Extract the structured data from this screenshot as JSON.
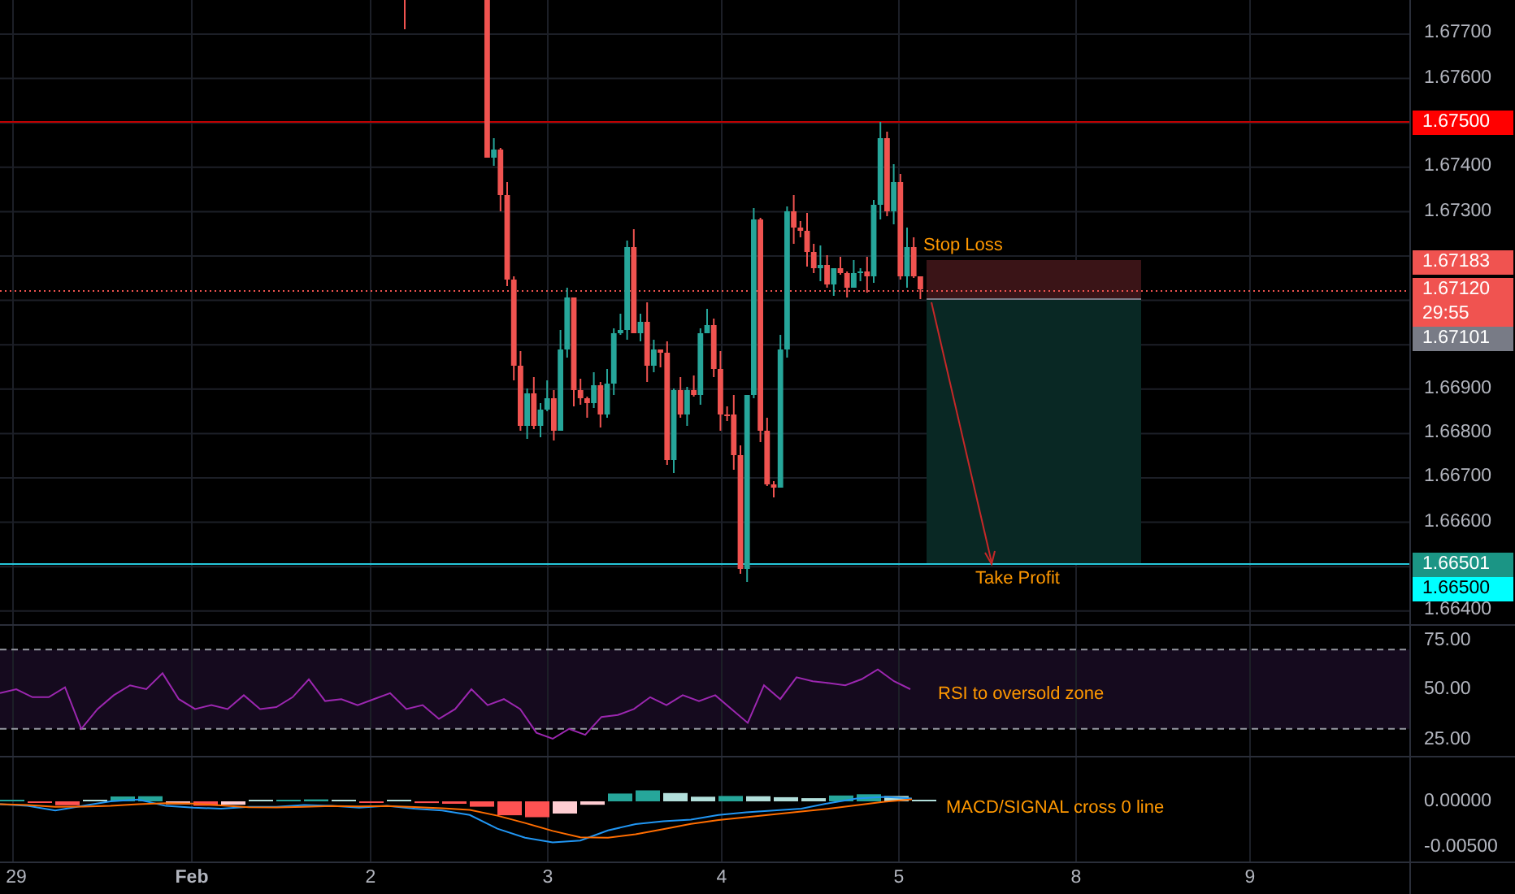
{
  "main_pane": {
    "annotations": [
      {
        "kind": "stop",
        "text": "Stop Loss"
      },
      {
        "kind": "target",
        "text": "Take Profit"
      }
    ],
    "price_axis": {
      "ticks": [
        "1.67700",
        "1.67600",
        "1.67400",
        "1.67300",
        "1.66900",
        "1.66800",
        "1.66700",
        "1.66600",
        "1.66400"
      ],
      "badges": [
        {
          "label": "1.67500",
          "color": "#ff0000"
        },
        {
          "label": "1.67183",
          "color": "#f05350"
        },
        {
          "label": "1.67120",
          "color": "#f05350"
        },
        {
          "label": "29:55",
          "color": "#f05350"
        },
        {
          "label": "1.67101",
          "color": "#787b86"
        },
        {
          "label": "1.66501",
          "color": "#1b9585"
        },
        {
          "label": "1.66500",
          "color": "#00ffff"
        }
      ]
    }
  },
  "rsi_pane": {
    "annotation": "RSI to oversold zone",
    "ticks": [
      "75.00",
      "50.00",
      "25.00"
    ]
  },
  "macd_pane": {
    "annotation": "MACD/SIGNAL cross 0 line",
    "ticks": [
      "0.00000",
      "-0.00500"
    ]
  },
  "time_axis": {
    "labels": [
      {
        "text": "29",
        "bold": false
      },
      {
        "text": "Feb",
        "bold": true
      },
      {
        "text": "2",
        "bold": false
      },
      {
        "text": "3",
        "bold": false
      },
      {
        "text": "4",
        "bold": false
      },
      {
        "text": "5",
        "bold": false
      },
      {
        "text": "8",
        "bold": false
      },
      {
        "text": "9",
        "bold": false
      }
    ]
  }
}
